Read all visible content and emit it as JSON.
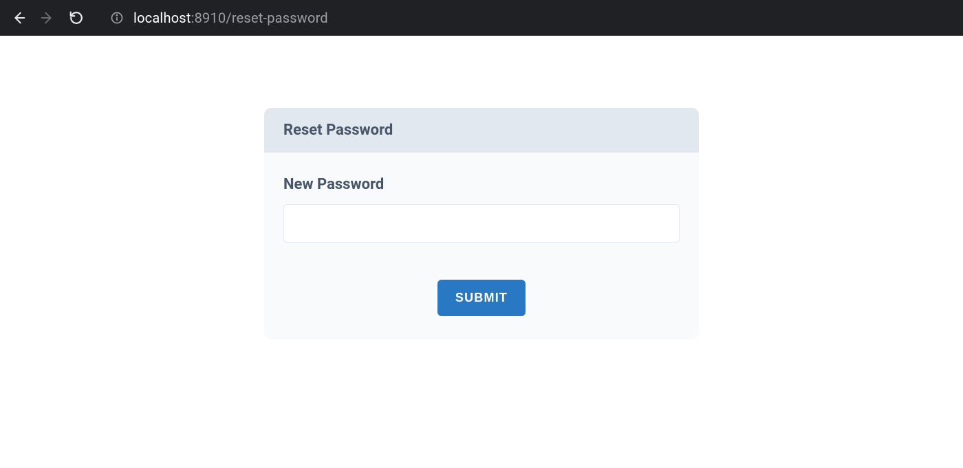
{
  "browser": {
    "url": {
      "host": "localhost",
      "rest": ":8910/reset-password"
    }
  },
  "card": {
    "title": "Reset Password",
    "password_label": "New Password",
    "password_value": "",
    "submit_label": "Submit"
  }
}
